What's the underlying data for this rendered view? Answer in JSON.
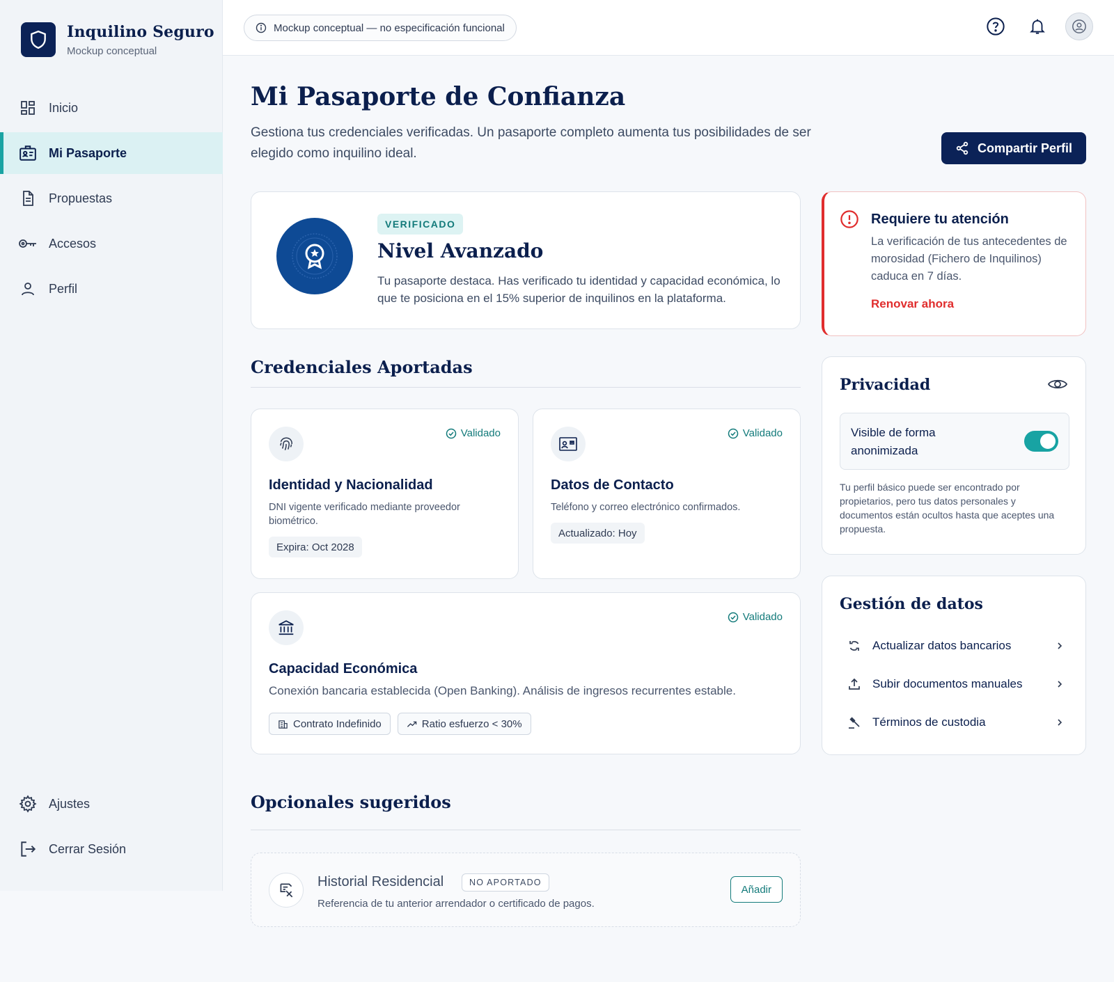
{
  "brand": {
    "title": "Inquilino Seguro",
    "subtitle": "Mockup conceptual"
  },
  "sidebar": {
    "items": [
      {
        "label": "Inicio",
        "icon": "dashboard-icon"
      },
      {
        "label": "Mi Pasaporte",
        "icon": "id-badge-icon",
        "active": true
      },
      {
        "label": "Propuestas",
        "icon": "document-icon"
      },
      {
        "label": "Accesos",
        "icon": "key-icon"
      },
      {
        "label": "Perfil",
        "icon": "user-icon"
      }
    ],
    "bottom": [
      {
        "label": "Ajustes",
        "icon": "gear-icon"
      },
      {
        "label": "Cerrar Sesión",
        "icon": "logout-icon"
      }
    ]
  },
  "topbar": {
    "notice": "Mockup conceptual — no especificación funcional"
  },
  "page": {
    "title": "Mi Pasaporte de Confianza",
    "description": "Gestiona tus credenciales verificadas. Un pasaporte completo aumenta tus posibilidades de ser elegido como inquilino ideal.",
    "share_label": "Compartir Perfil"
  },
  "level": {
    "badge": "VERIFICADO",
    "title": "Nivel Avanzado",
    "description": "Tu pasaporte destaca. Has verificado tu identidad y capacidad económica, lo que te posiciona en el 15% superior de inquilinos en la plataforma."
  },
  "credentials": {
    "title": "Credenciales Aportadas",
    "items": [
      {
        "status": "Validado",
        "title": "Identidad y Nacionalidad",
        "description": "DNI vigente verificado mediante proveedor biométrico.",
        "tag": "Expira: Oct 2028",
        "icon": "fingerprint-icon"
      },
      {
        "status": "Validado",
        "title": "Datos de Contacto",
        "description": "Teléfono y correo electrónico confirmados.",
        "tag": "Actualizado: Hoy",
        "icon": "contact-card-icon"
      },
      {
        "status": "Validado",
        "title": "Capacidad Económica",
        "description": "Conexión bancaria establecida (Open Banking). Análisis de ingresos recurrentes estable.",
        "tags": [
          "Contrato Indefinido",
          "Ratio esfuerzo < 30%"
        ],
        "icon": "bank-icon"
      }
    ]
  },
  "optional": {
    "title": "Opcionales sugeridos",
    "item": {
      "title": "Historial Residencial",
      "badge": "NO APORTADO",
      "description": "Referencia de tu anterior arrendador o certificado de pagos.",
      "action": "Añadir"
    }
  },
  "alert": {
    "title": "Requiere tu atención",
    "description": "La verificación de tus antecedentes de morosidad (Fichero de Inquilinos) caduca en 7 días.",
    "action": "Renovar ahora"
  },
  "privacy": {
    "title": "Privacidad",
    "toggle_label": "Visible de forma anonimizada",
    "toggle_on": true,
    "note": "Tu perfil básico puede ser encontrado por propietarios, pero tus datos personales y documentos están ocultos hasta que aceptes una propuesta."
  },
  "data_management": {
    "title": "Gestión de datos",
    "items": [
      {
        "label": "Actualizar datos bancarios",
        "icon": "refresh-icon"
      },
      {
        "label": "Subir documentos manuales",
        "icon": "upload-icon"
      },
      {
        "label": "Términos de custodia",
        "icon": "gavel-icon"
      }
    ]
  },
  "colors": {
    "navy": "#0b2257",
    "teal": "#1aa3a3",
    "alert": "#e02d2d"
  }
}
